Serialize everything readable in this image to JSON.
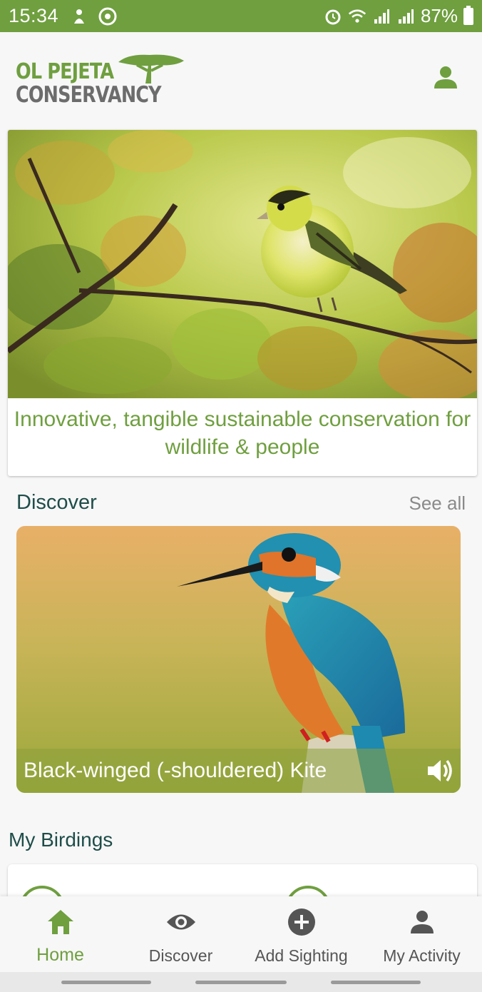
{
  "status_bar": {
    "time": "15:34",
    "battery": "87%",
    "left_icons": [
      "usb-debug-icon",
      "sync-app-icon"
    ],
    "right_icons": [
      "alarm-icon",
      "wifi-icon",
      "signal-icon",
      "signal-icon",
      "battery-icon"
    ]
  },
  "header": {
    "logo_line1": "OL PEJETA",
    "logo_line2": "CONSERVANCY",
    "profile_icon": "person-icon"
  },
  "hero": {
    "image": "yellow-bird-on-branch",
    "tagline": "Innovative, tangible sustainable conservation for wildlife & people"
  },
  "discover": {
    "title": "Discover",
    "see_all": "See all",
    "card": {
      "image": "kingfisher-photo",
      "caption": "Black-winged (-shouldered) Kite",
      "audio_icon": "volume-icon"
    }
  },
  "birdings": {
    "title": "My Birdings"
  },
  "bottom_nav": {
    "items": [
      {
        "label": "Home",
        "icon": "home-icon",
        "active": true
      },
      {
        "label": "Discover",
        "icon": "eye-icon",
        "active": false
      },
      {
        "label": "Add Sighting",
        "icon": "add-circle-icon",
        "active": false
      },
      {
        "label": "My Activity",
        "icon": "person-icon",
        "active": false
      }
    ]
  },
  "colors": {
    "brand_green": "#6f9f3f",
    "title_teal": "#1e4d49",
    "logo_grey": "#6c6c6c"
  }
}
